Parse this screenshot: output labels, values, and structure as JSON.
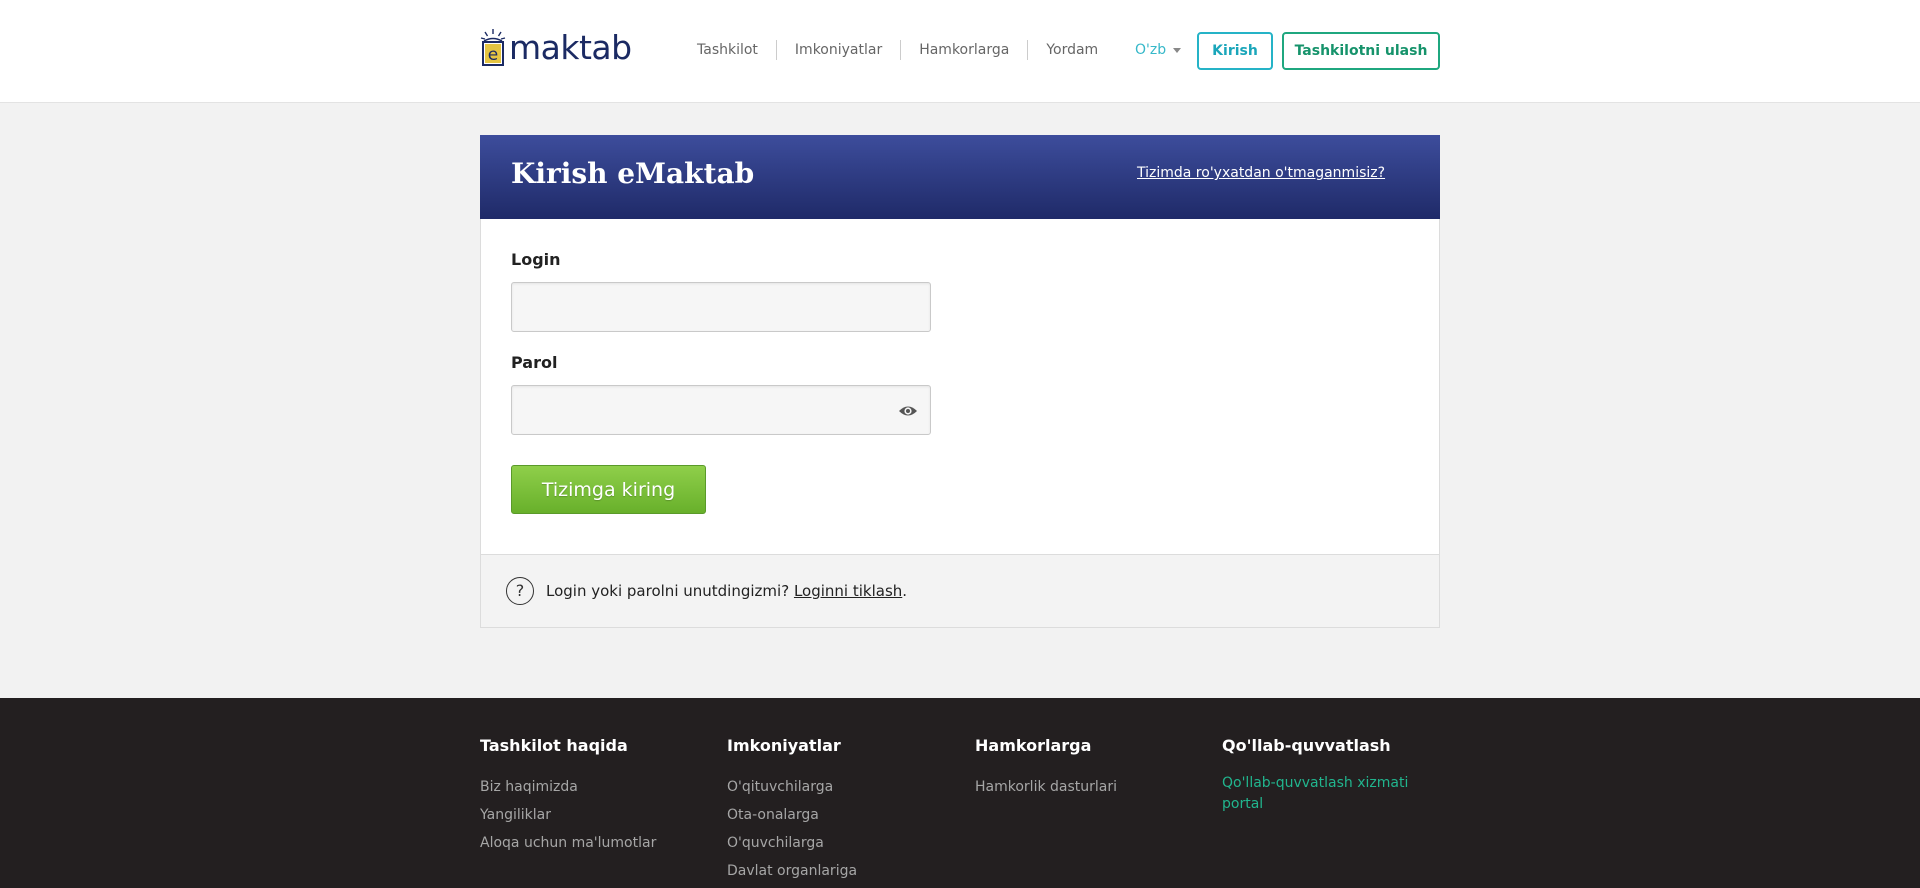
{
  "header": {
    "logo_text": "maktab",
    "nav": [
      "Tashkilot",
      "Imkoniyatlar",
      "Hamkorlarga",
      "Yordam"
    ],
    "language": "O'zb",
    "login_button": "Kirish",
    "connect_button": "Tashkilotni ulash"
  },
  "login_card": {
    "title": "Kirish eMaktab",
    "register_link": "Tizimda ro'yxatdan o'tmaganmisiz?",
    "login_label": "Login",
    "login_value": "",
    "password_label": "Parol",
    "password_value": "",
    "submit_button": "Tizimga kiring",
    "forgot_text": "Login yoki parolni unutdingizmi?",
    "forgot_link": "Loginni tiklash",
    "forgot_suffix": "."
  },
  "footer": {
    "columns": [
      {
        "title": "Tashkilot haqida",
        "links": [
          "Biz haqimizda",
          "Yangiliklar",
          "Aloqa uchun ma'lumotlar"
        ]
      },
      {
        "title": "Imkoniyatlar",
        "links": [
          "O'qituvchilarga",
          "Ota-onalarga",
          "O'quvchilarga",
          "Davlat organlariga"
        ]
      },
      {
        "title": "Hamkorlarga",
        "links": [
          "Hamkorlik dasturlari"
        ]
      },
      {
        "title": "Qo'llab-quvvatlash",
        "links": [
          "Qo'llab-quvvatlash xizmati portal"
        ]
      }
    ]
  },
  "colors": {
    "brand_navy": "#1b2a63",
    "accent_teal": "#25b3c7",
    "accent_green": "#1fa77f",
    "submit_green": "#7cc13b",
    "footer_bg": "#231f20"
  },
  "icons": [
    "logo-icon",
    "caret-down-icon",
    "eye-icon",
    "question-icon"
  ]
}
